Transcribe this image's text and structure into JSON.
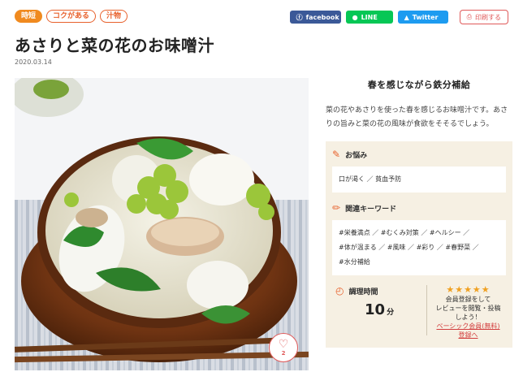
{
  "tags": [
    "時短",
    "コクがある",
    "汁物"
  ],
  "share": {
    "facebook": "facebook",
    "line": "LINE",
    "twitter": "Twitter",
    "print": "印刷する"
  },
  "title": "あさりと菜の花のお味噌汁",
  "date": "2020.03.14",
  "likes": "2",
  "side": {
    "heading": "春を感じながら鉄分補給",
    "description": "菜の花やあさりを使った春を感じるお味噌汁です。あさりの旨みと菜の花の風味が食欲をそそるでしょう。",
    "concern_title": "お悩み",
    "concerns": "口が渇く ／ 貧血予防",
    "keyword_title": "関連キーワード",
    "keywords_line1": "#栄養満点 ／ #むくみ対策 ／ #ヘルシー ／",
    "keywords_line2": "#体が温まる ／ #風味 ／ #彩り ／ #春野菜 ／",
    "keywords_line3": "#水分補給",
    "cook_title": "調理時間",
    "cook_time": "10",
    "cook_unit": "分",
    "review_line1": "会員登録をして",
    "review_line2": "レビューを閲覧・投稿",
    "review_line3": "しよう！",
    "member_link": "ベーシック会員(無料)",
    "register_link": "登録へ"
  },
  "colors": {
    "accent": "#e8612c",
    "facebook": "#3b5998",
    "line": "#06c755",
    "twitter": "#1d9bf0",
    "panel": "#f6f0e3"
  }
}
